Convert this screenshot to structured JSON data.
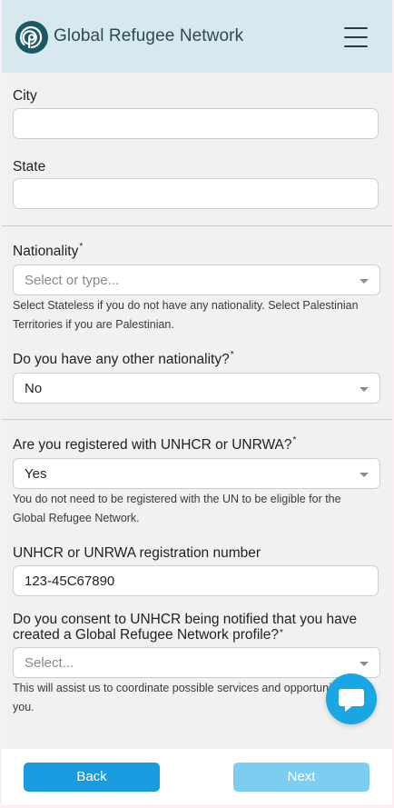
{
  "header": {
    "brand": "Global Refugee Network",
    "logo_icon": "logo-icon",
    "menu_icon": "hamburger-menu-icon"
  },
  "form": {
    "city": {
      "label": "City",
      "value": ""
    },
    "state": {
      "label": "State",
      "value": ""
    },
    "nationality": {
      "label": "Nationality",
      "required": "*",
      "placeholder": "Select or type...",
      "help": "Select Stateless if you do not have any nationality. Select Palestinian Territories if you are Palestinian."
    },
    "other_nationality": {
      "label": "Do you have any other nationality?",
      "required": "*",
      "value": "No"
    },
    "registered": {
      "label": "Are you registered with UNHCR or UNRWA?",
      "required": "*",
      "value": "Yes",
      "help": "You do not need to be registered with the UN to be eligible for the Global Refugee Network."
    },
    "registration_number": {
      "label": "UNHCR or UNRWA registration number",
      "value": "123-45C67890"
    },
    "consent": {
      "label_line1": "Do you consent to UNHCR being notified that you have",
      "label_line2": "created a Global Refugee Network profile?",
      "required": "*",
      "placeholder": "Select...",
      "help": "This will assist us to coordinate possible services and opportunities for you."
    }
  },
  "footer": {
    "back_label": "Back",
    "next_label": "Next"
  },
  "chat": {
    "icon": "chat-icon"
  },
  "colors": {
    "header_bg": "#d7e8ee",
    "primary": "#1a9be0",
    "primary_disabled": "#7ccdf0",
    "chat": "#1aa6e2"
  }
}
